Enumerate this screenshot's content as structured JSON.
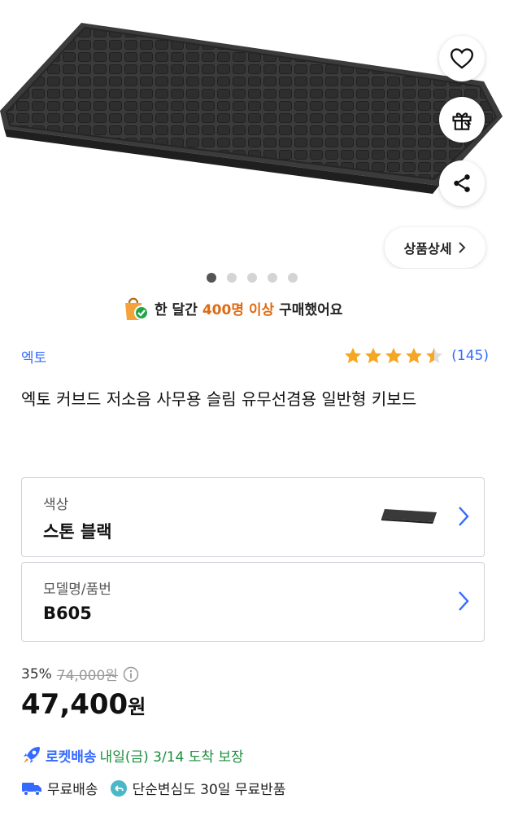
{
  "gallery": {
    "page_count": 5,
    "active_index": 0
  },
  "actions": {
    "wishlist_icon": "heart-icon",
    "gift_icon": "gift-icon",
    "share_icon": "share-icon",
    "detail_label": "상품상세"
  },
  "social_proof": {
    "prefix": "한 달간",
    "highlight": "400명 이상",
    "suffix": "구매했어요"
  },
  "product": {
    "brand": "엑토",
    "rating": 4.5,
    "review_count": "(145)",
    "title": "엑토 커브드 저소음 사무용 슬림 유무선겸용 일반형 키보드"
  },
  "options": {
    "color_label": "색상",
    "color_value": "스톤 블랙",
    "model_label": "모델명/품번",
    "model_value": "B605"
  },
  "pricing": {
    "discount": "35%",
    "original_price": "74,000원",
    "price": "47,400",
    "unit": "원"
  },
  "delivery": {
    "rocket_label": "로켓배송",
    "eta": "내일(금) 3/14 도착 보장",
    "free_shipping": "무료배송",
    "returns": "단순변심도 30일 무료반품"
  },
  "colors": {
    "accent": "#346aff",
    "highlight": "#e06a12",
    "eta": "#1a8f3c",
    "star": "#f5a623"
  }
}
